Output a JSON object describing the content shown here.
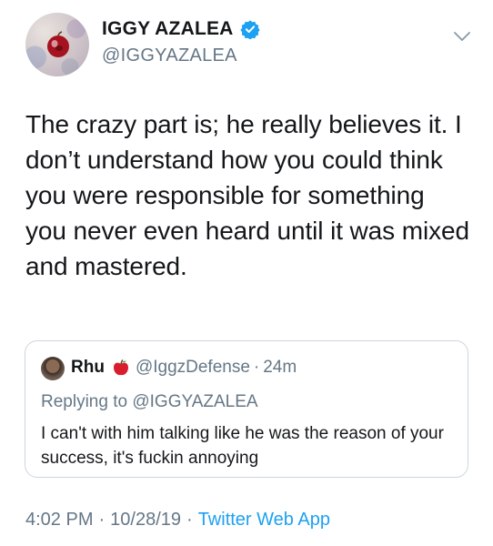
{
  "author": {
    "display_name": "IGGY AZALEA",
    "handle": "@IGGYAZALEA",
    "verified": true,
    "avatar_icon": "apple-painting-avatar"
  },
  "tweet": {
    "text": "The crazy part is; he really believes it. I don’t understand how you could think you were responsible for something you never even heard until it was mixed and mastered."
  },
  "quoted_tweet": {
    "display_name": "Rhu",
    "emoji": "red-apple",
    "handle": "@IggzDefense",
    "separator": "·",
    "time": "24m",
    "replying_to_prefix": "Replying to",
    "replying_to_handle": "@IGGYAZALEA",
    "text": "I can't with him talking like he was the reason of your success, it's fuckin annoying"
  },
  "meta": {
    "time": "4:02 PM",
    "date": "10/28/19",
    "separator": "·",
    "source": "Twitter Web App"
  },
  "colors": {
    "text": "#14171a",
    "secondary": "#657786",
    "accent": "#1da1f2",
    "border": "#ccd6dd"
  }
}
